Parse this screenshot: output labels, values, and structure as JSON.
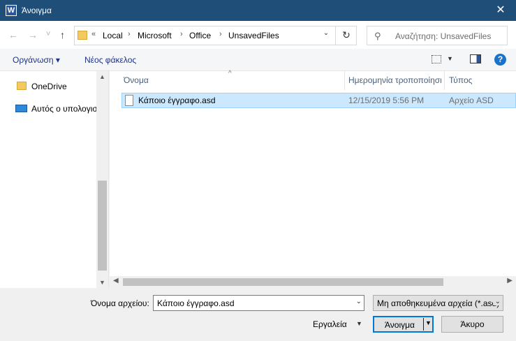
{
  "window": {
    "title": "Άνοιγμα",
    "app_icon_letter": "W",
    "close_glyph": "✕"
  },
  "nav": {
    "back_glyph": "←",
    "forward_glyph": "→",
    "recent_glyph": "˅",
    "up_glyph": "↑",
    "address": {
      "overflow": "«",
      "segments": [
        "Local",
        "Microsoft",
        "Office",
        "UnsavedFiles"
      ],
      "separator": "›",
      "dropdown_glyph": "⌄"
    },
    "refresh_glyph": "↻",
    "search": {
      "icon_glyph": "⚲",
      "placeholder": "Αναζήτηση: UnsavedFiles"
    }
  },
  "toolbar": {
    "organize": "Οργάνωση ▾",
    "new_folder": "Νέος φάκελος",
    "views_arrow": "▼",
    "help": "?"
  },
  "sidebar": {
    "items": [
      {
        "label": "OneDrive",
        "icon": "folder-icon"
      },
      {
        "label": "Αυτός ο υπολογιστής",
        "icon": "computer-icon"
      }
    ],
    "scroll_up": "▲",
    "scroll_down": "▼"
  },
  "file_list": {
    "sort_glyph": "^",
    "columns": [
      "Όνομα",
      "Ημερομηνία τροποποίησης",
      "Τύπος"
    ],
    "rows": [
      {
        "name": "Κάποιο έγγραφο.asd",
        "modified": "12/15/2019 5:56 PM",
        "type": "Αρχείο ASD"
      }
    ],
    "scroll_left": "◀",
    "scroll_right": "▶"
  },
  "bottom": {
    "filename_label": "Όνομα αρχείου:",
    "filename_value": "Κάποιο έγγραφο.asd",
    "dropdown_glyph": "⌄",
    "filetype_value": "Μη αποθηκευμένα αρχεία (*.asd)",
    "tools_label": "Εργαλεία",
    "tools_arrow": "▼",
    "open_label": "Άνοιγμα",
    "open_arrow": "▼",
    "cancel_label": "Άκυρο"
  },
  "colors": {
    "titlebar": "#1f4e79",
    "selection": "#cce8ff",
    "accent": "#0078d7"
  }
}
